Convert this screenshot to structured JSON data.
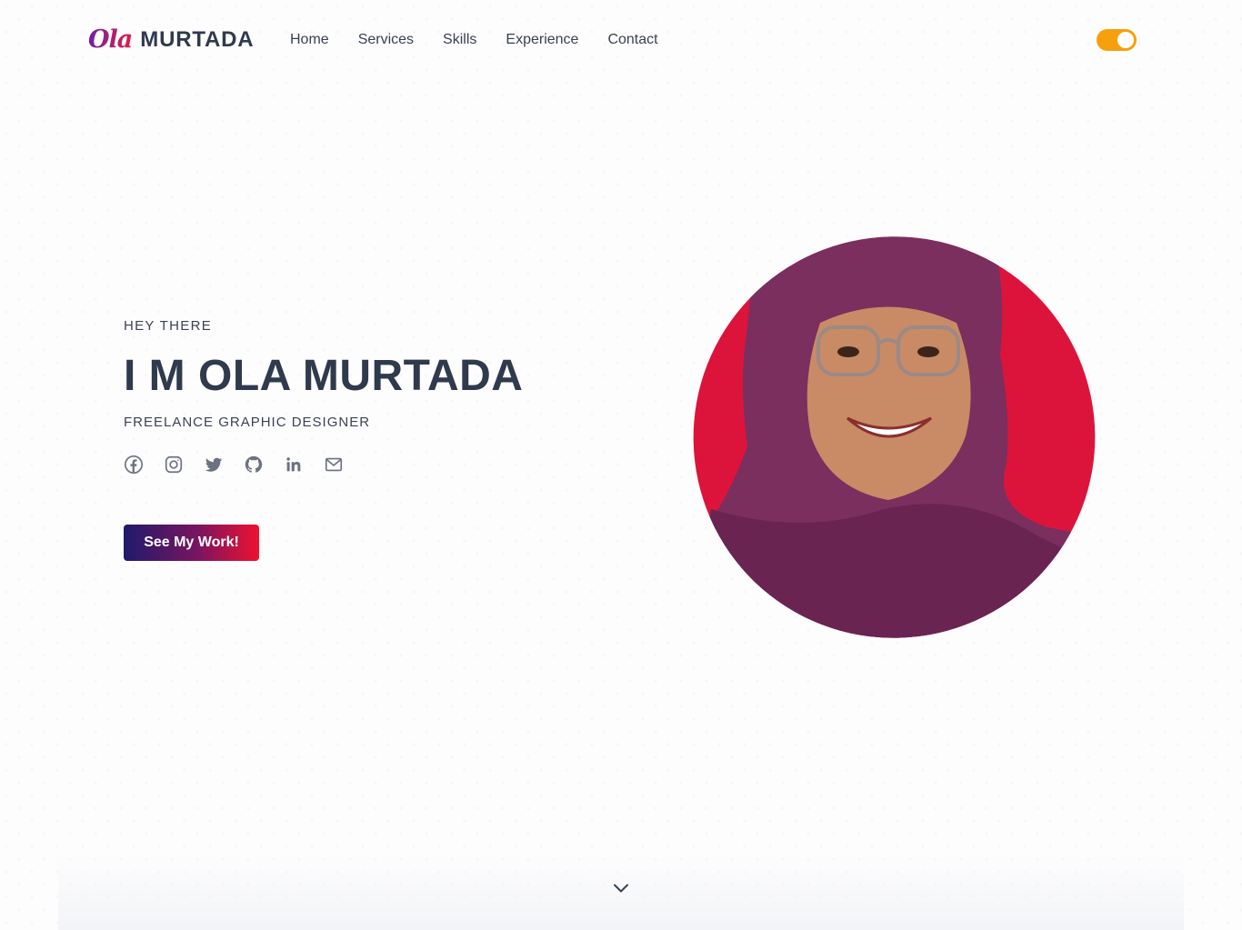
{
  "header": {
    "logo_script": "Ola",
    "logo_name": "MURTADA",
    "nav": [
      {
        "label": "Home"
      },
      {
        "label": "Services"
      },
      {
        "label": "Skills"
      },
      {
        "label": "Experience"
      },
      {
        "label": "Contact"
      }
    ],
    "theme_toggle": {
      "state": "on",
      "color": "#f5a00c"
    }
  },
  "hero": {
    "greeting": "HEY THERE",
    "title": "I M OLA MURTADA",
    "role": "FREELANCE GRAPHIC DESIGNER",
    "cta_label": "See My Work!",
    "socials": [
      {
        "icon": "facebook-icon"
      },
      {
        "icon": "instagram-icon"
      },
      {
        "icon": "twitter-icon"
      },
      {
        "icon": "github-icon"
      },
      {
        "icon": "linkedin-icon"
      },
      {
        "icon": "mail-icon"
      }
    ]
  },
  "portrait": {
    "background_color": "#dc143c",
    "scarf_color": "#7a2f5e"
  },
  "scroll": {
    "icon": "chevron-down-icon"
  }
}
